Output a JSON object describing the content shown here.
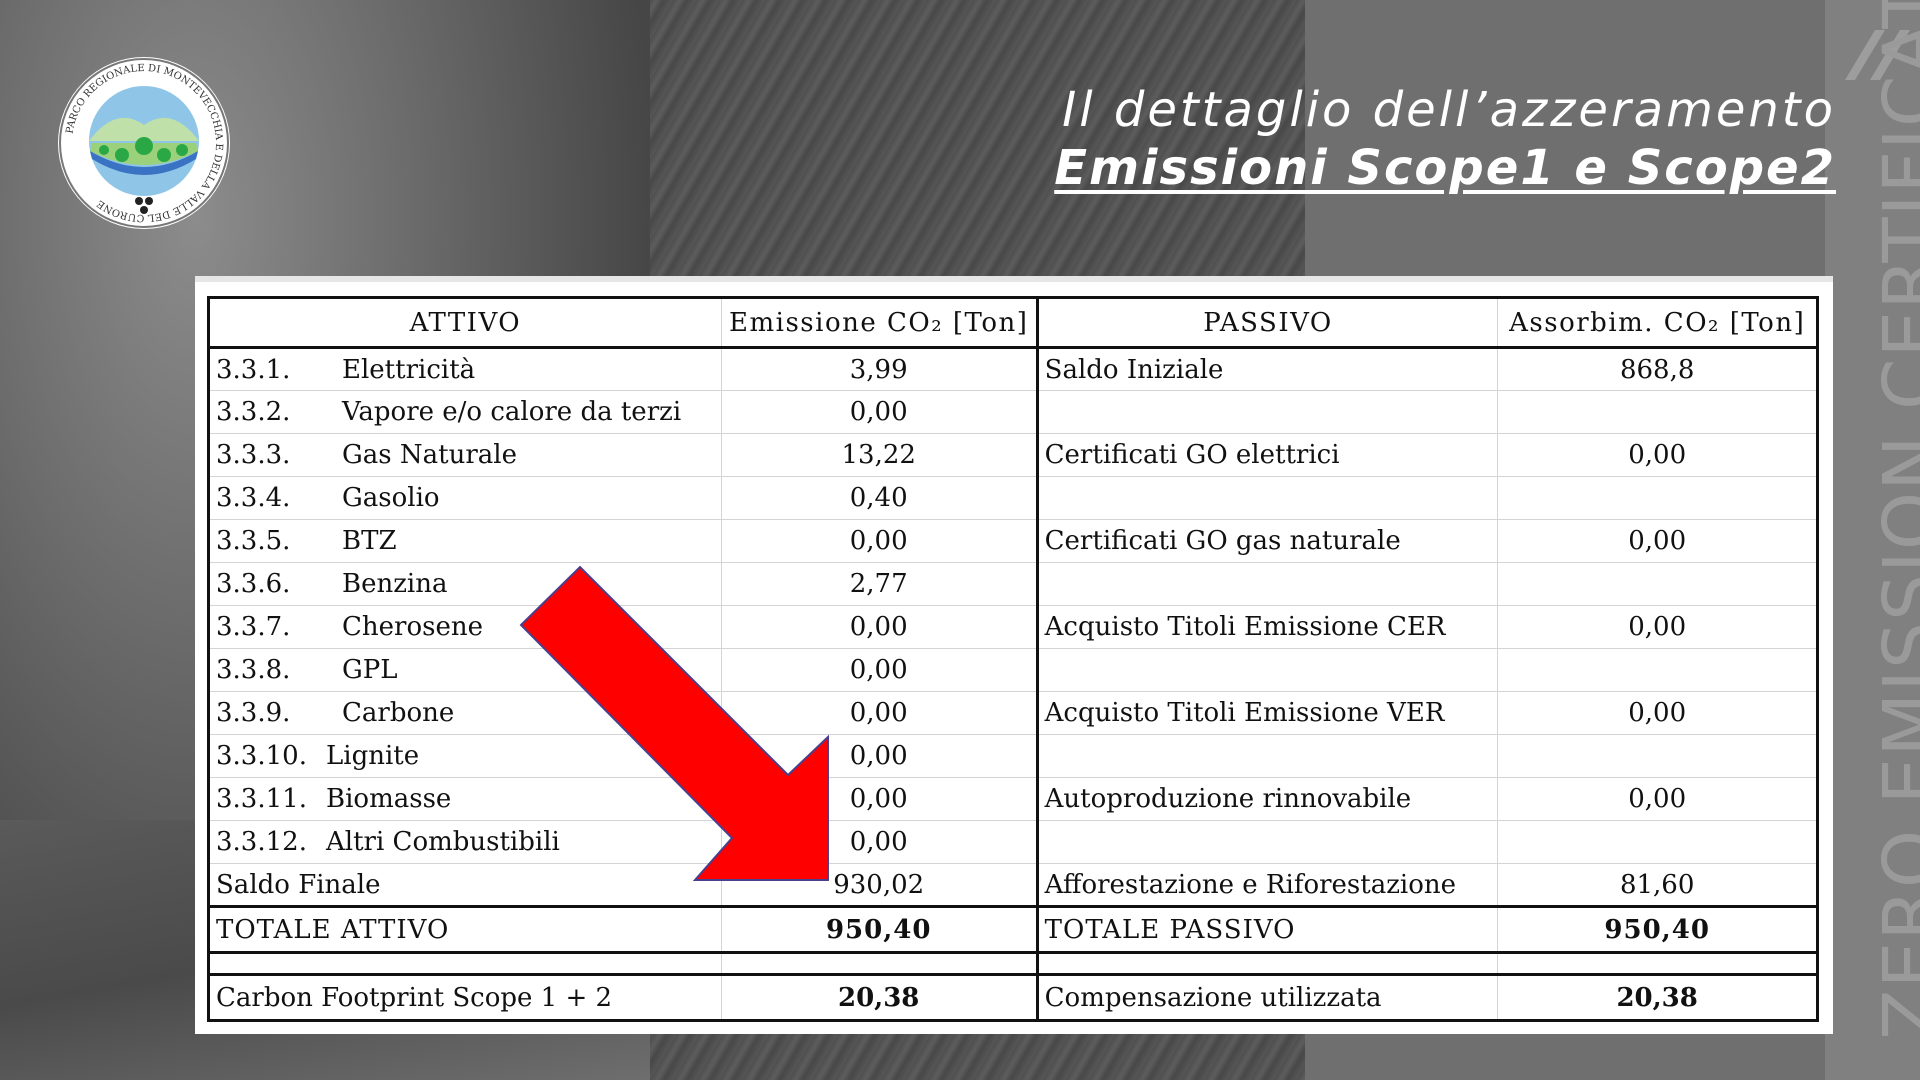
{
  "header": {
    "title_line1": "Il dettaglio dell’azzeramento",
    "title_line2": "Emissioni Scope1 e Scope2"
  },
  "logo": {
    "ring_text": "PARCO REGIONALE DI MONTEVECCHIA E DELLA VALLE DEL CURONE"
  },
  "side_strip": {
    "text": "ZERO EMISSION CERTIFICATE"
  },
  "table": {
    "headers": {
      "attivo": "ATTIVO",
      "emissione": "Emissione CO₂ [Ton]",
      "passivo": "PASSIVO",
      "assorbim": "Assorbim. CO₂ [Ton]"
    },
    "rows": [
      {
        "code": "3.3.1.",
        "label": "Elettricità",
        "emissione": "3,99",
        "passivo": "Saldo Iniziale",
        "assorbim": "868,8"
      },
      {
        "code": "3.3.2.",
        "label": "Vapore e/o calore da terzi",
        "emissione": "0,00",
        "passivo": "",
        "assorbim": ""
      },
      {
        "code": "3.3.3.",
        "label": "Gas Naturale",
        "emissione": "13,22",
        "passivo": "Certificati GO elettrici",
        "assorbim": "0,00"
      },
      {
        "code": "3.3.4.",
        "label": "Gasolio",
        "emissione": "0,40",
        "passivo": "",
        "assorbim": ""
      },
      {
        "code": "3.3.5.",
        "label": "BTZ",
        "emissione": "0,00",
        "passivo": "Certificati GO gas naturale",
        "assorbim": "0,00"
      },
      {
        "code": "3.3.6.",
        "label": "Benzina",
        "emissione": "2,77",
        "passivo": "",
        "assorbim": ""
      },
      {
        "code": "3.3.7.",
        "label": "Cherosene",
        "emissione": "0,00",
        "passivo": "Acquisto Titoli Emissione CER",
        "assorbim": "0,00"
      },
      {
        "code": "3.3.8.",
        "label": "GPL",
        "emissione": "0,00",
        "passivo": "",
        "assorbim": ""
      },
      {
        "code": "3.3.9.",
        "label": "Carbone",
        "emissione": "0,00",
        "passivo": "Acquisto Titoli Emissione VER",
        "assorbim": "0,00"
      },
      {
        "code": "3.3.10.",
        "label": "Lignite",
        "emissione": "0,00",
        "passivo": "",
        "assorbim": ""
      },
      {
        "code": "3.3.11.",
        "label": "Biomasse",
        "emissione": "0,00",
        "passivo": "Autoproduzione rinnovabile",
        "assorbim": "0,00"
      },
      {
        "code": "3.3.12.",
        "label": "Altri Combustibili",
        "emissione": "0,00",
        "passivo": "",
        "assorbim": ""
      }
    ],
    "saldo_finale": {
      "label": "Saldo Finale",
      "emissione": "930,02",
      "passivo": "Afforestazione e Riforestazione",
      "assorbim": "81,60"
    },
    "totale": {
      "attivo_label": "TOTALE ATTIVO",
      "attivo_value": "950,40",
      "passivo_label": "TOTALE PASSIVO",
      "passivo_value": "950,40"
    },
    "footer": {
      "left_label": "Carbon Footprint Scope 1 + 2",
      "left_value": "20,38",
      "right_label": "Compensazione utilizzata",
      "right_value": "20,38"
    }
  },
  "colors": {
    "arrow": "#ff0000",
    "arrow_outline": "#4a3f8c",
    "title": "#ffffff"
  }
}
